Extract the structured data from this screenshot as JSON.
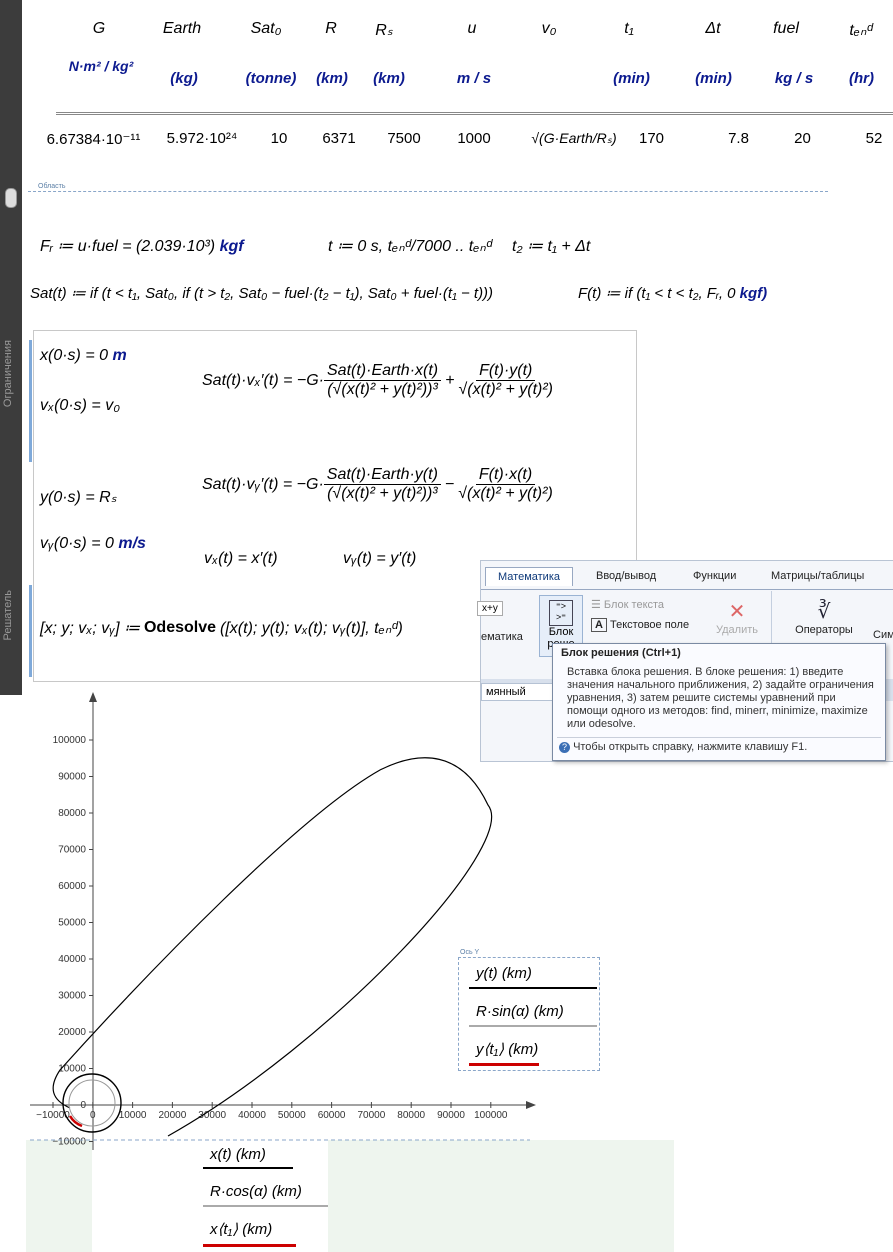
{
  "table": {
    "headers": [
      "G",
      "Earth",
      "Sat₀",
      "R",
      "Rₛ",
      "u",
      "v₀",
      "t₁",
      "Δt",
      "fuel",
      "tₑₙᵈ"
    ],
    "units": [
      "N·m² / kg²",
      "(kg)",
      "(tonne)",
      "(km)",
      "(km)",
      "m / s",
      "",
      "(min)",
      "(min)",
      "kg / s",
      "(hr)"
    ],
    "values": [
      "6.67384·10⁻¹¹",
      "5.972·10²⁴",
      "10",
      "6371",
      "7500",
      "1000",
      "√(G·Earth/Rₛ)",
      "170",
      "7.8",
      "20",
      "52"
    ]
  },
  "region_label": "Область",
  "equations": {
    "fr": "Fᵣ ≔ u·fuel = (2.039·10³)",
    "fr_unit": "kgf",
    "t_def": "t ≔ 0 s, tₑₙᵈ/7000 .. tₑₙᵈ",
    "t2_def": "t₂ ≔ t₁ + Δt",
    "sat_def": "Sat(t) ≔ if (t < t₁, Sat₀, if (t > t₂, Sat₀ − fuel·(t₂ − t₁), Sat₀ + fuel·(t₁ − t)))",
    "f_def": "F(t) ≔ if (t₁ < t < t₂, Fᵣ, 0",
    "f_unit": "kgf)",
    "x0": "x(0·s) = 0",
    "x0_unit": "m",
    "vx0": "vₓ(0·s) = v₀",
    "y0": "y(0·s) = Rₛ",
    "vy0": "vᵧ(0·s) = 0",
    "vy0_unit": "m/s",
    "ode_x_lhs": "Sat(t)·vₓ′(t) = −G·",
    "ode_x_num1": "Sat(t)·Earth·x(t)",
    "ode_x_den1": "(√(x(t)² + y(t)²))³",
    "ode_x_num2": "F(t)·y(t)",
    "ode_x_den2": "√(x(t)² + y(t)²)",
    "ode_y_lhs": "Sat(t)·vᵧ′(t) = −G·",
    "ode_y_num1": "Sat(t)·Earth·y(t)",
    "ode_y_den1": "(√(x(t)² + y(t)²))³",
    "ode_y_num2": "F(t)·x(t)",
    "ode_y_den2": "√(x(t)² + y(t)²)",
    "vx_def": "vₓ(t) = x′(t)",
    "vy_def": "vᵧ(t) = y′(t)",
    "odesolve_lhs": "[x; y; vₓ; vᵧ] ≔",
    "odesolve_fn": "Odesolve",
    "odesolve_args": "([x(t); y(t); vₓ(t); vᵧ(t)], tₑₙᵈ)"
  },
  "sidebar": {
    "label_top": "Ограничения",
    "label_bottom": "Решатель"
  },
  "ribbon": {
    "tabs": [
      "Математика",
      "Ввод/вывод",
      "Функции",
      "Матрицы/таблицы"
    ],
    "math_region_short": "x+y",
    "math_label": "ематика",
    "solve_block_label": "Блок реше",
    "text_block": "Блок текста",
    "text_field": "Текстовое поле",
    "delete": "Удалить",
    "operators": "Операторы",
    "symbols": "Сим",
    "bottom_tab": "мянный"
  },
  "tooltip": {
    "title": "Блок решения (Ctrl+1)",
    "body": "Вставка блока решения. В блоке решения: 1) введите значения начального приближения, 2) задайте ограничения уравнения, 3) затем решите системы уравнений при помощи одного из методов: find, minerr, minimize, maximize или odesolve.",
    "help": "Чтобы открыть справку, нажмите клавишу F1."
  },
  "plot": {
    "axis_y_label": "Ось Y",
    "y_legend": [
      "y(t)  (km)",
      "R·sin(α)  (km)",
      "y⟨t₁⟩  (km)"
    ],
    "x_legend": [
      "x(t)  (km)",
      "R·cos(α)  (km)",
      "x⟨t₁⟩  (km)"
    ],
    "x_ticks": [
      "−10000",
      "0",
      "10000",
      "20000",
      "30000",
      "40000",
      "50000",
      "60000",
      "70000",
      "80000",
      "90000",
      "100000"
    ],
    "y_ticks": [
      "100000",
      "90000",
      "80000",
      "70000",
      "60000",
      "50000",
      "40000",
      "30000",
      "20000",
      "10000",
      "0",
      "−10000"
    ],
    "colors": {
      "trajectory": "#000000",
      "planet": "#000000",
      "burn": "#cc0000",
      "grid_bg": "#eef5ee"
    }
  }
}
